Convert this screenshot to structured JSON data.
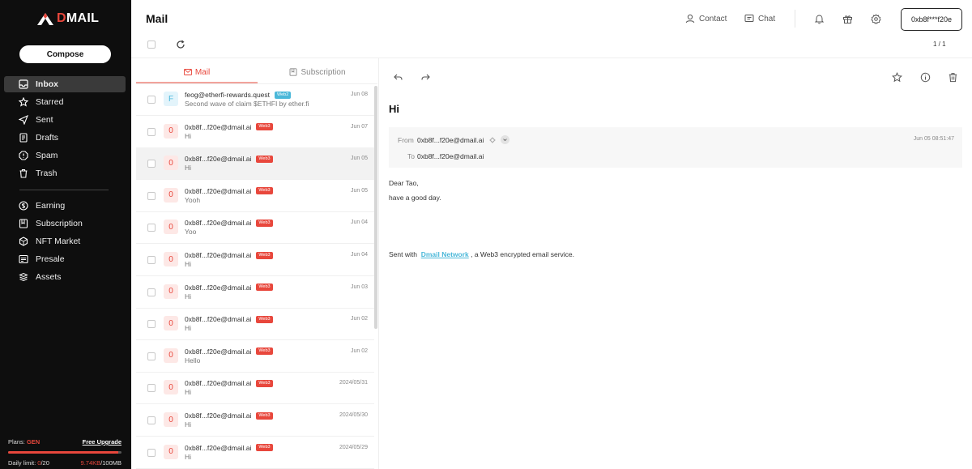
{
  "brand": {
    "logo_text_d": "D",
    "logo_text_rest": "MAIL",
    "accent_color": "#e8473c",
    "web2_color": "#4bb8d9"
  },
  "sidebar": {
    "compose_label": "Compose",
    "items": [
      {
        "label": "Inbox",
        "icon": "inbox-icon",
        "active": true
      },
      {
        "label": "Starred",
        "icon": "star-icon"
      },
      {
        "label": "Sent",
        "icon": "send-icon"
      },
      {
        "label": "Drafts",
        "icon": "drafts-icon"
      },
      {
        "label": "Spam",
        "icon": "spam-icon"
      },
      {
        "label": "Trash",
        "icon": "trash-icon"
      }
    ],
    "items2": [
      {
        "label": "Earning",
        "icon": "dollar-icon"
      },
      {
        "label": "Subscription",
        "icon": "subscription-icon"
      },
      {
        "label": "NFT Market",
        "icon": "nft-icon"
      },
      {
        "label": "Presale",
        "icon": "presale-icon"
      },
      {
        "label": "Assets",
        "icon": "assets-icon"
      }
    ],
    "plans_label": "Plans:",
    "plan_name": "GEN",
    "upgrade_label": "Free Upgrade",
    "storage_fill_fraction": 0.97,
    "daily_limit_label": "Daily limit:",
    "daily_used": "0",
    "daily_total": "/20",
    "storage_used": "9.74KB",
    "storage_total": "/100MB"
  },
  "header": {
    "title": "Mail",
    "contact_label": "Contact",
    "chat_label": "Chat",
    "wallet": "0xb8f***f20e"
  },
  "toolbar": {
    "pager": "1 / 1"
  },
  "tabs": {
    "mail": "Mail",
    "subscription": "Subscription"
  },
  "list": [
    {
      "avatar": "F",
      "sender": "feog@etherfi-rewards.quest",
      "badge": "Web2",
      "subject": "Second wave of claim $ETHFI by ether.fi",
      "date": "Jun 08"
    },
    {
      "avatar": "0",
      "sender": "0xb8f...f20e@dmail.ai",
      "badge": "Web3",
      "subject": "Hi",
      "date": "Jun 07"
    },
    {
      "avatar": "0",
      "sender": "0xb8f...f20e@dmail.ai",
      "badge": "Web3",
      "subject": "Hi",
      "date": "Jun 05",
      "selected": true
    },
    {
      "avatar": "0",
      "sender": "0xb8f...f20e@dmail.ai",
      "badge": "Web3",
      "subject": "Yooh",
      "date": "Jun 05"
    },
    {
      "avatar": "0",
      "sender": "0xb8f...f20e@dmail.ai",
      "badge": "Web3",
      "subject": "Yoo",
      "date": "Jun 04"
    },
    {
      "avatar": "0",
      "sender": "0xb8f...f20e@dmail.ai",
      "badge": "Web3",
      "subject": "Hi",
      "date": "Jun 04"
    },
    {
      "avatar": "0",
      "sender": "0xb8f...f20e@dmail.ai",
      "badge": "Web3",
      "subject": "Hi",
      "date": "Jun 03"
    },
    {
      "avatar": "0",
      "sender": "0xb8f...f20e@dmail.ai",
      "badge": "Web3",
      "subject": "Hi",
      "date": "Jun 02"
    },
    {
      "avatar": "0",
      "sender": "0xb8f...f20e@dmail.ai",
      "badge": "Web3",
      "subject": "Hello",
      "date": "Jun 02"
    },
    {
      "avatar": "0",
      "sender": "0xb8f...f20e@dmail.ai",
      "badge": "Web3",
      "subject": "Hi",
      "date": "2024/05/31"
    },
    {
      "avatar": "0",
      "sender": "0xb8f...f20e@dmail.ai",
      "badge": "Web3",
      "subject": "Hi",
      "date": "2024/05/30"
    },
    {
      "avatar": "0",
      "sender": "0xb8f...f20e@dmail.ai",
      "badge": "Web3",
      "subject": "Hi",
      "date": "2024/05/29"
    }
  ],
  "message": {
    "title": "Hi",
    "from_label": "From",
    "from": "0xb8f...f20e@dmail.ai",
    "to_label": "To",
    "to": "0xb8f...f20e@dmail.ai",
    "date": "Jun 05 08:51:47",
    "greeting": "Dear Tao,",
    "line1": "have a good day.",
    "sig_prefix": "Sent with",
    "sig_link": "Dmail Network",
    "sig_suffix": ", a Web3 encrypted email service."
  }
}
